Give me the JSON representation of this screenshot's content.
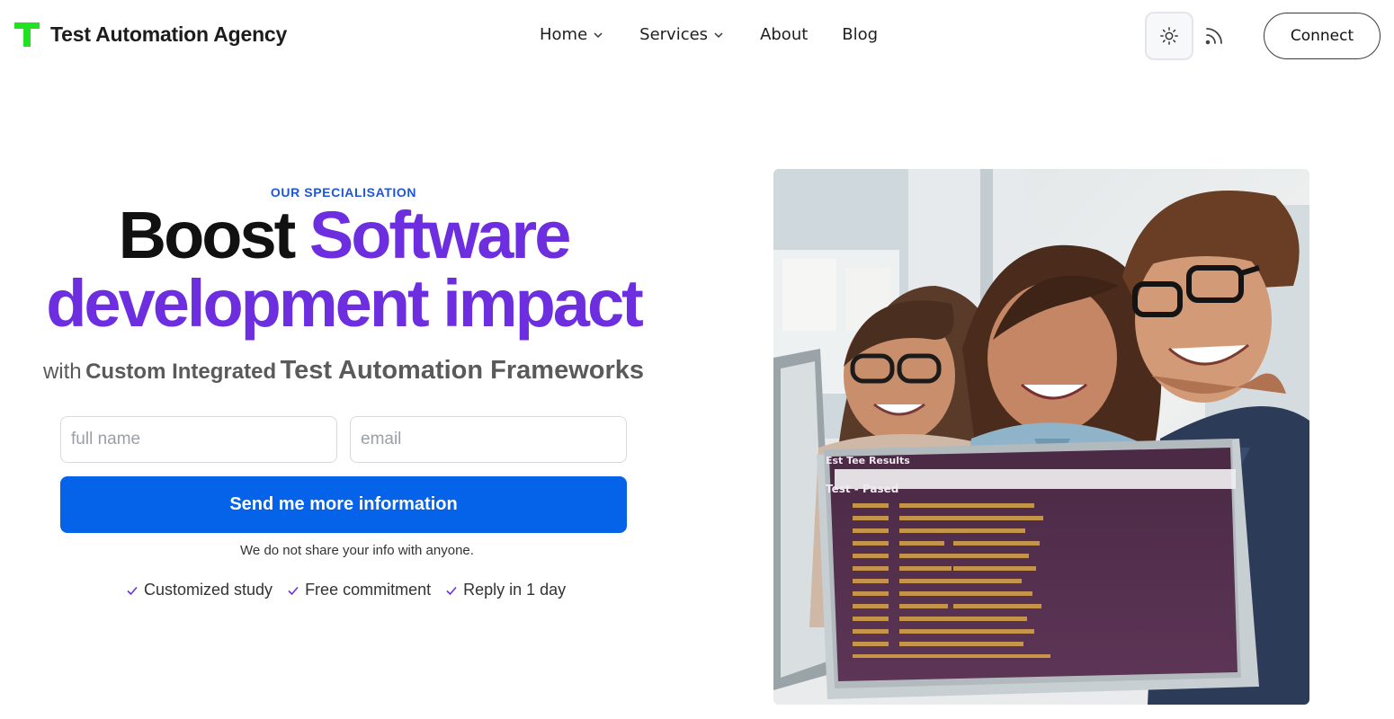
{
  "header": {
    "brand": "Test Automation Agency",
    "nav": {
      "home": "Home",
      "services": "Services",
      "about": "About",
      "blog": "Blog"
    },
    "connect_label": "Connect"
  },
  "hero": {
    "eyebrow": "OUR SPECIALISATION",
    "headline_dark": "Boost",
    "headline_purple_1": "Software",
    "headline_purple_2": "development impact",
    "sub_1": "with",
    "sub_2": "Custom Integrated",
    "sub_3": "Test Automation Frameworks",
    "form": {
      "name_placeholder": "full name",
      "email_placeholder": "email",
      "submit_label": "Send me more information",
      "privacy_note": "We do not share your info with anyone."
    },
    "benefits": [
      "Customized study",
      "Free commitment",
      "Reply in 1 day"
    ],
    "image": {
      "screen_title": "Est Tee Results",
      "screen_subtitle": "Test  -  Pased"
    }
  },
  "colors": {
    "accent_purple": "#6d2ee0",
    "button_blue": "#0563e9",
    "eyebrow_blue": "#1f56d6",
    "logo_green": "#22e022"
  }
}
